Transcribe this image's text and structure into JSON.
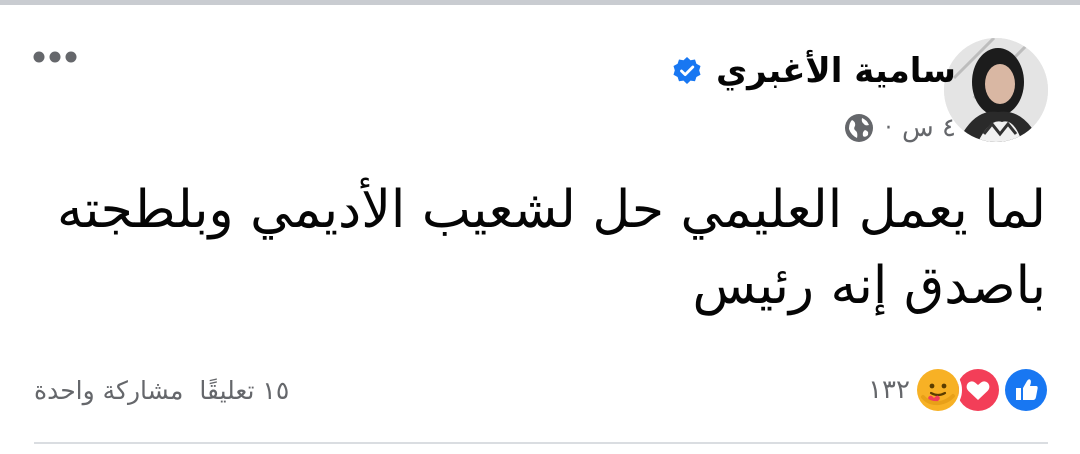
{
  "post": {
    "author_name": "سامية الأغبري",
    "verified": true,
    "time": "٤ س",
    "separator": "·",
    "audience_icon": "globe-icon",
    "more_icon": "more-dots-icon",
    "text_lines": [
      "لما يعمل العليمي حل لشعيب الأديمي وبلطجته",
      "باصدق إنه رئيس"
    ],
    "reactions": {
      "icons": [
        "like-icon",
        "love-icon",
        "care-icon"
      ],
      "count": "١٣٢"
    },
    "comments_label": "١٥ تعليقًا",
    "shares_label": "مشاركة واحدة"
  },
  "colors": {
    "verified_blue": "#1877f2",
    "like_blue": "#1877f2",
    "love_red": "#f33e58",
    "care_yellow": "#f7b125",
    "secondary_text": "#65676b"
  }
}
